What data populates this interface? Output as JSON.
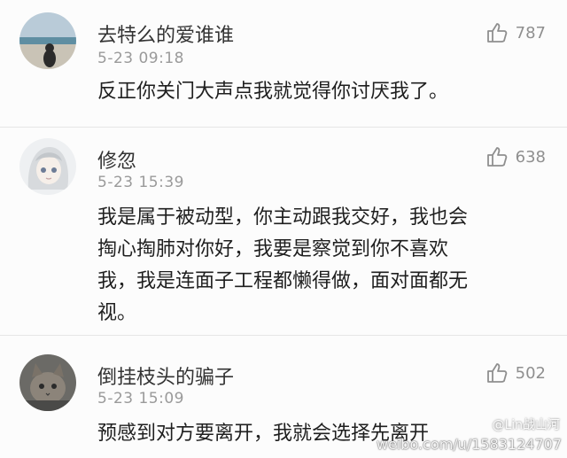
{
  "comments": [
    {
      "username": "去特么的爱谁谁",
      "time": "5-23 09:18",
      "likes": "787",
      "lines": [
        "反正你关门大声点我就觉得你讨厌我了。"
      ],
      "avatar_icon": "beach-silhouette-avatar"
    },
    {
      "username": "修忽",
      "time": "5-23 15:39",
      "likes": "638",
      "lines": [
        "我是属于被动型，你主动跟我交好，我也会",
        "掏心掏肺对你好，我要是察觉到你不喜欢",
        "我，我是连面子工程都懒得做，面对面都无",
        "视。"
      ],
      "avatar_icon": "anime-girl-avatar"
    },
    {
      "username": "倒挂枝头的骗子",
      "time": "5-23 15:09",
      "likes": "502",
      "lines": [
        "预感到对方要离开，我就会选择先离开"
      ],
      "avatar_icon": "cat-avatar"
    }
  ],
  "watermark": {
    "name": "@Lin战山河",
    "url": "weibo.com/u/1583124707"
  },
  "colors": {
    "background": "#fcfcfc",
    "meta_gray": "#9a9a9a",
    "like_gray": "#8f8f8f"
  }
}
